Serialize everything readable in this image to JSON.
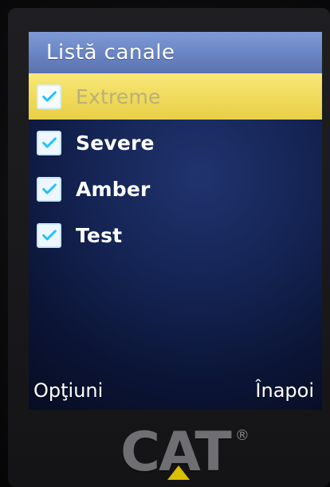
{
  "header": {
    "title": "Listă canale"
  },
  "channels": [
    {
      "label": "Extreme",
      "checked": true,
      "selected": true
    },
    {
      "label": "Severe",
      "checked": true,
      "selected": false
    },
    {
      "label": "Amber",
      "checked": true,
      "selected": false
    },
    {
      "label": "Test",
      "checked": true,
      "selected": false
    }
  ],
  "softkeys": {
    "left_label": "Opţiuni",
    "right_label": "Înapoi"
  },
  "brand": {
    "logo_text": "CAT",
    "registered_mark": "®"
  },
  "colors": {
    "header": "#6b86c4",
    "highlight": "#efda5a",
    "screen_bg": "#142454",
    "checkbox_check": "#22c2ff"
  },
  "icons": {
    "checkbox": "checkmark-icon"
  }
}
